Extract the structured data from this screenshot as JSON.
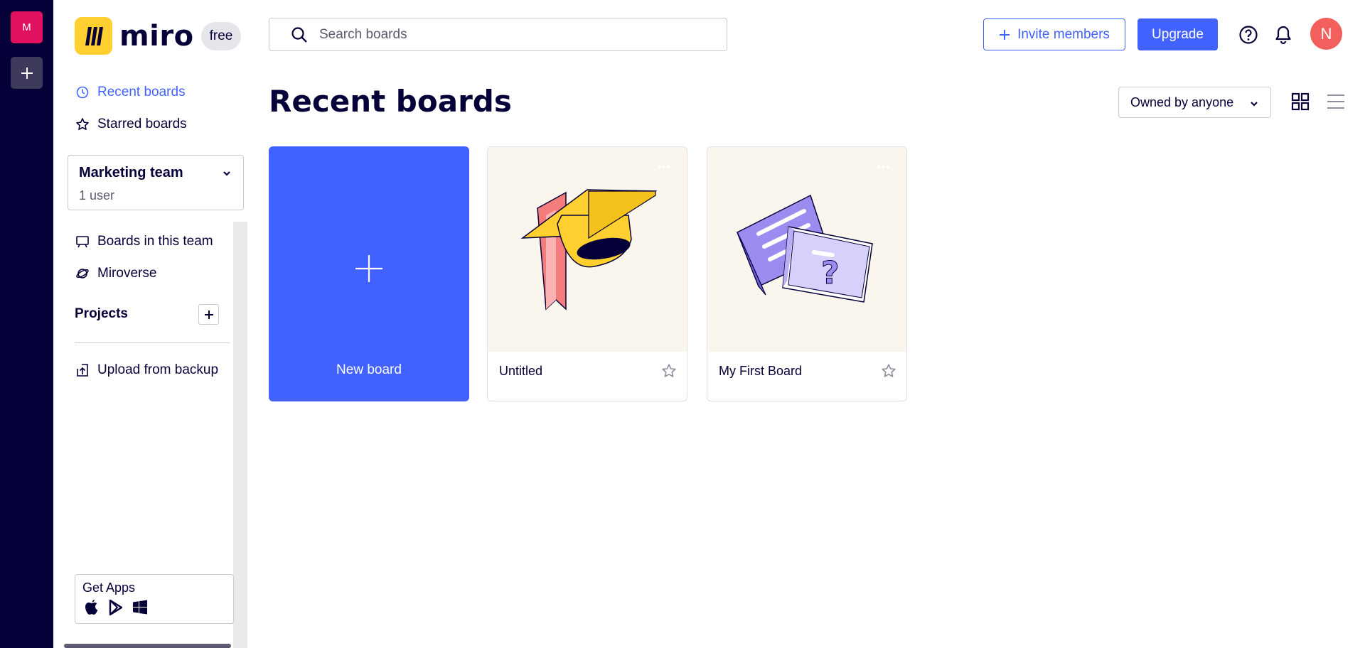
{
  "rail": {
    "team_initial": "M"
  },
  "sidebar": {
    "logo_text": "miro",
    "plan_badge": "free",
    "nav": {
      "recent": "Recent boards",
      "starred": "Starred boards"
    },
    "team": {
      "name": "Marketing team",
      "users": "1 user"
    },
    "team_nav": {
      "boards": "Boards in this team",
      "miroverse": "Miroverse"
    },
    "projects_label": "Projects",
    "upload": "Upload from backup",
    "get_apps": "Get Apps"
  },
  "topbar": {
    "search_placeholder": "Search boards",
    "invite_label": "Invite members",
    "upgrade_label": "Upgrade",
    "user_initial": "N"
  },
  "main": {
    "title": "Recent boards",
    "owner_filter": "Owned by anyone",
    "new_board_label": "New board",
    "boards": [
      {
        "title": "Untitled",
        "thumb_icon": "graduation-cap-icon",
        "starred": false
      },
      {
        "title": "My First Board",
        "thumb_icon": "question-cards-icon",
        "starred": false
      }
    ]
  },
  "colors": {
    "accent": "#4262ff",
    "rail": "#050038",
    "team_avatar": "#e0115f",
    "user_avatar": "#f25f5c",
    "logo_yellow": "#ffd02f"
  }
}
